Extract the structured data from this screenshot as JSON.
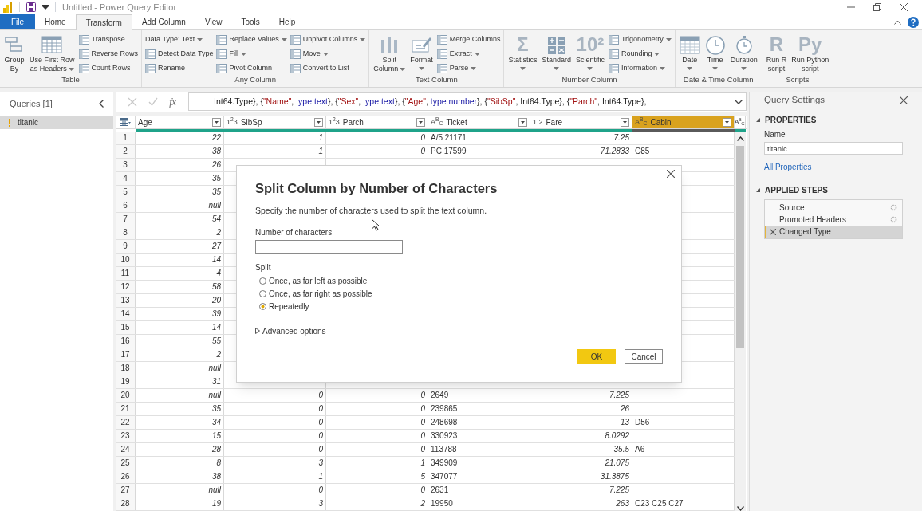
{
  "title_bar": {
    "title": "Untitled - Power Query Editor"
  },
  "tabs": [
    {
      "label": "File",
      "kind": "file",
      "selected": false
    },
    {
      "label": "Home",
      "kind": "tab",
      "selected": false
    },
    {
      "label": "Transform",
      "kind": "tab",
      "selected": true
    },
    {
      "label": "Add Column",
      "kind": "tab",
      "selected": false
    },
    {
      "label": "View",
      "kind": "tab",
      "selected": false
    },
    {
      "label": "Tools",
      "kind": "tab",
      "selected": false
    },
    {
      "label": "Help",
      "kind": "tab",
      "selected": false
    }
  ],
  "ribbon": [
    {
      "label": "Table",
      "items": [
        {
          "kind": "large",
          "lines": [
            "Group",
            "By"
          ],
          "dropdown": false
        },
        {
          "kind": "large",
          "lines": [
            "Use First Row",
            "as Headers"
          ],
          "dropdown": true
        },
        {
          "kind": "stack",
          "items": [
            {
              "label": "Transpose",
              "kind": "icon",
              "dropdown": false
            },
            {
              "label": "Reverse Rows",
              "kind": "icon",
              "dropdown": false
            },
            {
              "label": "Count Rows",
              "kind": "icon",
              "dropdown": false
            }
          ]
        }
      ]
    },
    {
      "label": "Any Column",
      "items": [
        {
          "kind": "stack",
          "items": [
            {
              "label": "Data Type: Text",
              "kind": "plain",
              "dropdown": true
            },
            {
              "label": "Detect Data Type",
              "kind": "icon",
              "dropdown": false
            },
            {
              "label": "Rename",
              "kind": "icon",
              "dropdown": false
            }
          ]
        },
        {
          "kind": "stack",
          "items": [
            {
              "label": "Replace Values",
              "kind": "icon",
              "dropdown": true
            },
            {
              "label": "Fill",
              "kind": "icon",
              "dropdown": true
            },
            {
              "label": "Pivot Column",
              "kind": "icon",
              "dropdown": false
            }
          ]
        },
        {
          "kind": "stack",
          "items": [
            {
              "label": "Unpivot Columns",
              "kind": "icon",
              "dropdown": true
            },
            {
              "label": "Move",
              "kind": "icon",
              "dropdown": true
            },
            {
              "label": "Convert to List",
              "kind": "icon",
              "dropdown": false
            }
          ]
        }
      ]
    },
    {
      "label": "Text Column",
      "items": [
        {
          "kind": "large",
          "lines": [
            "Split",
            "Column"
          ],
          "dropdown": true
        },
        {
          "kind": "large",
          "lines": [
            "Format"
          ],
          "dropdown": true
        },
        {
          "kind": "stack",
          "items": [
            {
              "label": "Merge Columns",
              "kind": "icon",
              "dropdown": false
            },
            {
              "label": "Extract",
              "kind": "icon",
              "dropdown": true
            },
            {
              "label": "Parse",
              "kind": "icon",
              "dropdown": true
            }
          ]
        }
      ]
    },
    {
      "label": "Number Column",
      "items": [
        {
          "kind": "large",
          "lines": [
            "Statistics"
          ],
          "icon_text": "Σ",
          "dropdown": true
        },
        {
          "kind": "large",
          "lines": [
            "Standard"
          ],
          "dropdown": true
        },
        {
          "kind": "large",
          "lines": [
            "Scientific"
          ],
          "icon_text": "10²",
          "dropdown": true
        },
        {
          "kind": "stack",
          "items": [
            {
              "label": "Trigonometry",
              "kind": "icon",
              "dropdown": true
            },
            {
              "label": "Rounding",
              "kind": "icon",
              "dropdown": true
            },
            {
              "label": "Information",
              "kind": "icon",
              "dropdown": true
            }
          ]
        }
      ]
    },
    {
      "label": "Date & Time Column",
      "items": [
        {
          "kind": "large",
          "lines": [
            "Date"
          ],
          "dropdown": true
        },
        {
          "kind": "large",
          "lines": [
            "Time"
          ],
          "dropdown": true
        },
        {
          "kind": "large",
          "lines": [
            "Duration"
          ],
          "dropdown": true
        }
      ]
    },
    {
      "label": "Scripts",
      "items": [
        {
          "kind": "large",
          "lines": [
            "Run R",
            "script"
          ],
          "icon_text": "R",
          "dropdown": false
        },
        {
          "kind": "large",
          "lines": [
            "Run Python",
            "script"
          ],
          "icon_text": "Py",
          "dropdown": false
        }
      ]
    }
  ],
  "queries": {
    "title": "Queries [1]",
    "items": [
      {
        "name": "titanic",
        "selected": true,
        "warning": true
      }
    ]
  },
  "formula_bar": {
    "function_label": "fx"
  },
  "formula": [
    {
      "text": "Int64.Type}, {",
      "kind": "plain"
    },
    {
      "text": "\"Name\"",
      "kind": "string"
    },
    {
      "text": ", ",
      "kind": "plain"
    },
    {
      "text": "type text",
      "kind": "keyword"
    },
    {
      "text": "}, {",
      "kind": "plain"
    },
    {
      "text": "\"Sex\"",
      "kind": "string"
    },
    {
      "text": ", ",
      "kind": "plain"
    },
    {
      "text": "type text",
      "kind": "keyword"
    },
    {
      "text": "}, {",
      "kind": "plain"
    },
    {
      "text": "\"Age\"",
      "kind": "string"
    },
    {
      "text": ", ",
      "kind": "plain"
    },
    {
      "text": "type number",
      "kind": "keyword"
    },
    {
      "text": "}, {",
      "kind": "plain"
    },
    {
      "text": "\"SibSp\"",
      "kind": "string"
    },
    {
      "text": ", Int64.Type}, {",
      "kind": "plain"
    },
    {
      "text": "\"Parch\"",
      "kind": "string"
    },
    {
      "text": ", Int64.Type},",
      "kind": "plain"
    }
  ],
  "table": {
    "columns": [
      {
        "name": "Age",
        "kind": "number",
        "selected": false
      },
      {
        "name": "SibSp",
        "kind": "number",
        "type_icon": "1$^{2}$3",
        "selected": false
      },
      {
        "name": "Parch",
        "kind": "number",
        "type_icon": "1$^{2}$3",
        "selected": false
      },
      {
        "name": "Ticket",
        "kind": "text",
        "type_icon": "A$^{B}$$_{C}$",
        "selected": false
      },
      {
        "name": "Fare",
        "kind": "number",
        "type_icon": "1.2",
        "selected": false
      },
      {
        "name": "Cabin",
        "kind": "text",
        "type_icon": "A$^{B}$$_{C}$",
        "selected": true
      },
      {
        "type_icon": "A$^{B}$$_{C}$",
        "selected": false
      }
    ],
    "rows": [
      {
        "number": "1",
        "cells": [
          "22",
          "1",
          "0",
          "A/5 21171",
          "7.25",
          null
        ]
      },
      {
        "number": "2",
        "cells": [
          "38",
          "1",
          "0",
          "PC 17599",
          "71.2833",
          "C85"
        ]
      },
      {
        "number": "3",
        "cells": [
          "26",
          null,
          null,
          null,
          null,
          null
        ]
      },
      {
        "number": "4",
        "cells": [
          "35",
          null,
          null,
          null,
          null,
          null
        ]
      },
      {
        "number": "5",
        "cells": [
          "35",
          null,
          null,
          null,
          null,
          null
        ]
      },
      {
        "number": "6",
        "cells": [
          "null",
          null,
          null,
          null,
          null,
          null
        ]
      },
      {
        "number": "7",
        "cells": [
          "54",
          null,
          null,
          null,
          null,
          null
        ]
      },
      {
        "number": "8",
        "cells": [
          "2",
          null,
          null,
          null,
          null,
          null
        ]
      },
      {
        "number": "9",
        "cells": [
          "27",
          null,
          null,
          null,
          null,
          null
        ]
      },
      {
        "number": "10",
        "cells": [
          "14",
          null,
          null,
          null,
          null,
          null
        ]
      },
      {
        "number": "11",
        "cells": [
          "4",
          null,
          null,
          null,
          null,
          null
        ]
      },
      {
        "number": "12",
        "cells": [
          "58",
          null,
          null,
          null,
          null,
          null
        ]
      },
      {
        "number": "13",
        "cells": [
          "20",
          null,
          null,
          null,
          null,
          null
        ]
      },
      {
        "number": "14",
        "cells": [
          "39",
          null,
          null,
          null,
          null,
          null
        ]
      },
      {
        "number": "15",
        "cells": [
          "14",
          null,
          null,
          null,
          null,
          null
        ]
      },
      {
        "number": "16",
        "cells": [
          "55",
          null,
          null,
          null,
          null,
          null
        ]
      },
      {
        "number": "17",
        "cells": [
          "2",
          null,
          null,
          null,
          null,
          null
        ]
      },
      {
        "number": "18",
        "cells": [
          "null",
          null,
          null,
          null,
          null,
          null
        ]
      },
      {
        "number": "19",
        "cells": [
          "31",
          null,
          null,
          null,
          null,
          null
        ]
      },
      {
        "number": "20",
        "cells": [
          "null",
          "0",
          "0",
          "2649",
          "7.225",
          null
        ]
      },
      {
        "number": "21",
        "cells": [
          "35",
          "0",
          "0",
          "239865",
          "26",
          null
        ]
      },
      {
        "number": "22",
        "cells": [
          "34",
          "0",
          "0",
          "248698",
          "13",
          "D56"
        ]
      },
      {
        "number": "23",
        "cells": [
          "15",
          "0",
          "0",
          "330923",
          "8.0292",
          null
        ]
      },
      {
        "number": "24",
        "cells": [
          "28",
          "0",
          "0",
          "113788",
          "35.5",
          "A6"
        ]
      },
      {
        "number": "25",
        "cells": [
          "8",
          "3",
          "1",
          "349909",
          "21.075",
          null
        ]
      },
      {
        "number": "26",
        "cells": [
          "38",
          "1",
          "5",
          "347077",
          "31.3875",
          null
        ]
      },
      {
        "number": "27",
        "cells": [
          "null",
          "0",
          "0",
          "2631",
          "7.225",
          null
        ]
      },
      {
        "number": "28",
        "cells": [
          "19",
          "3",
          "2",
          "19950",
          "263",
          "C23 C25 C27"
        ]
      }
    ]
  },
  "dialog": {
    "title": "Split Column by Number of Characters",
    "description": "Specify the number of characters used to split the text column.",
    "field_label": "Number of characters",
    "split_label": "Split",
    "options": [
      {
        "label": "Once, as far left as possible",
        "selected": false
      },
      {
        "label": "Once, as far right as possible",
        "selected": false
      },
      {
        "label": "Repeatedly",
        "selected": true
      }
    ],
    "advanced": {
      "label": "Advanced options",
      "expanded": false
    },
    "buttons": [
      {
        "label": "OK",
        "kind": "primary"
      },
      {
        "label": "Cancel",
        "kind": "secondary"
      }
    ]
  },
  "query_settings": {
    "title": "Query Settings",
    "properties_heading": "PROPERTIES",
    "name_label": "Name",
    "name_value": "titanic",
    "all_properties": "All Properties",
    "steps_heading": "APPLIED STEPS",
    "steps": [
      {
        "label": "Source",
        "settings": true,
        "selected": false
      },
      {
        "label": "Promoted Headers",
        "settings": true,
        "selected": false
      },
      {
        "label": "Changed Type",
        "settings": false,
        "selected": true
      }
    ]
  }
}
